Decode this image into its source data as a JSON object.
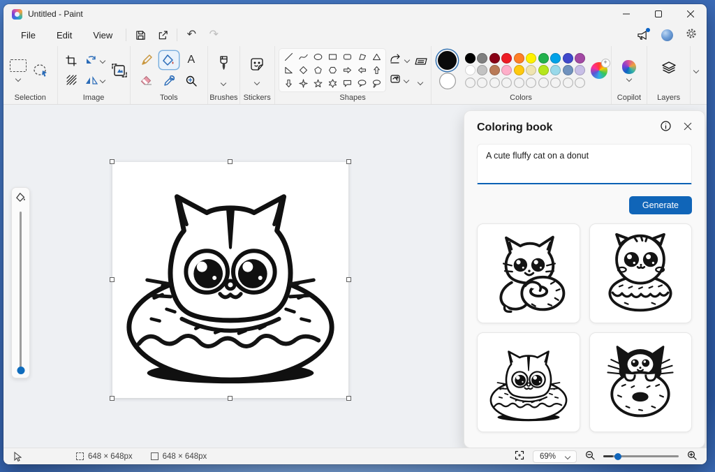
{
  "window": {
    "title": "Untitled - Paint"
  },
  "menubar": {
    "items": [
      "File",
      "Edit",
      "View"
    ]
  },
  "ribbon": {
    "group_labels": {
      "selection": "Selection",
      "image": "Image",
      "tools": "Tools",
      "brushes": "Brushes",
      "stickers": "Stickers",
      "shapes": "Shapes",
      "colors": "Colors",
      "copilot": "Copilot",
      "layers": "Layers"
    },
    "text_tool_glyph": "A",
    "shapes": [
      "line",
      "curve",
      "oval",
      "rectangle",
      "rounded-rectangle",
      "polygon",
      "triangle",
      "right-triangle",
      "diamond",
      "pentagon",
      "hexagon",
      "right-arrow",
      "left-arrow",
      "up-arrow",
      "down-arrow",
      "four-point-star",
      "five-point-star",
      "six-point-star",
      "rounded-callout",
      "oval-callout",
      "cloud-callout",
      "heart",
      "lightning"
    ],
    "colors": {
      "primary": "#0a0a0a",
      "secondary": "#ffffff",
      "palette": [
        [
          "#000000",
          "#7f7f7f",
          "#880015",
          "#ed1c24",
          "#ff7f27",
          "#fff200",
          "#22b14c",
          "#00a2e8",
          "#3f48cc",
          "#a349a4"
        ],
        [
          "#ffffff",
          "#c3c3c3",
          "#b97a57",
          "#ffaec9",
          "#ffc90e",
          "#efe4b0",
          "#b5e61d",
          "#99d9ea",
          "#7092be",
          "#c8bfe7"
        ]
      ],
      "empty_slots": 10
    }
  },
  "coloring_book": {
    "title": "Coloring book",
    "prompt": "A cute fluffy cat on a donut",
    "generate_label": "Generate",
    "thumbnails": [
      {
        "name": "cat-hugging-donut"
      },
      {
        "name": "fluffy-round-cat-on-donut"
      },
      {
        "name": "cat-head-in-donut"
      },
      {
        "name": "black-cat-behind-donut"
      }
    ]
  },
  "statusbar": {
    "selection_size": "648 × 648px",
    "canvas_size": "648 × 648px",
    "zoom_level": "69%"
  }
}
